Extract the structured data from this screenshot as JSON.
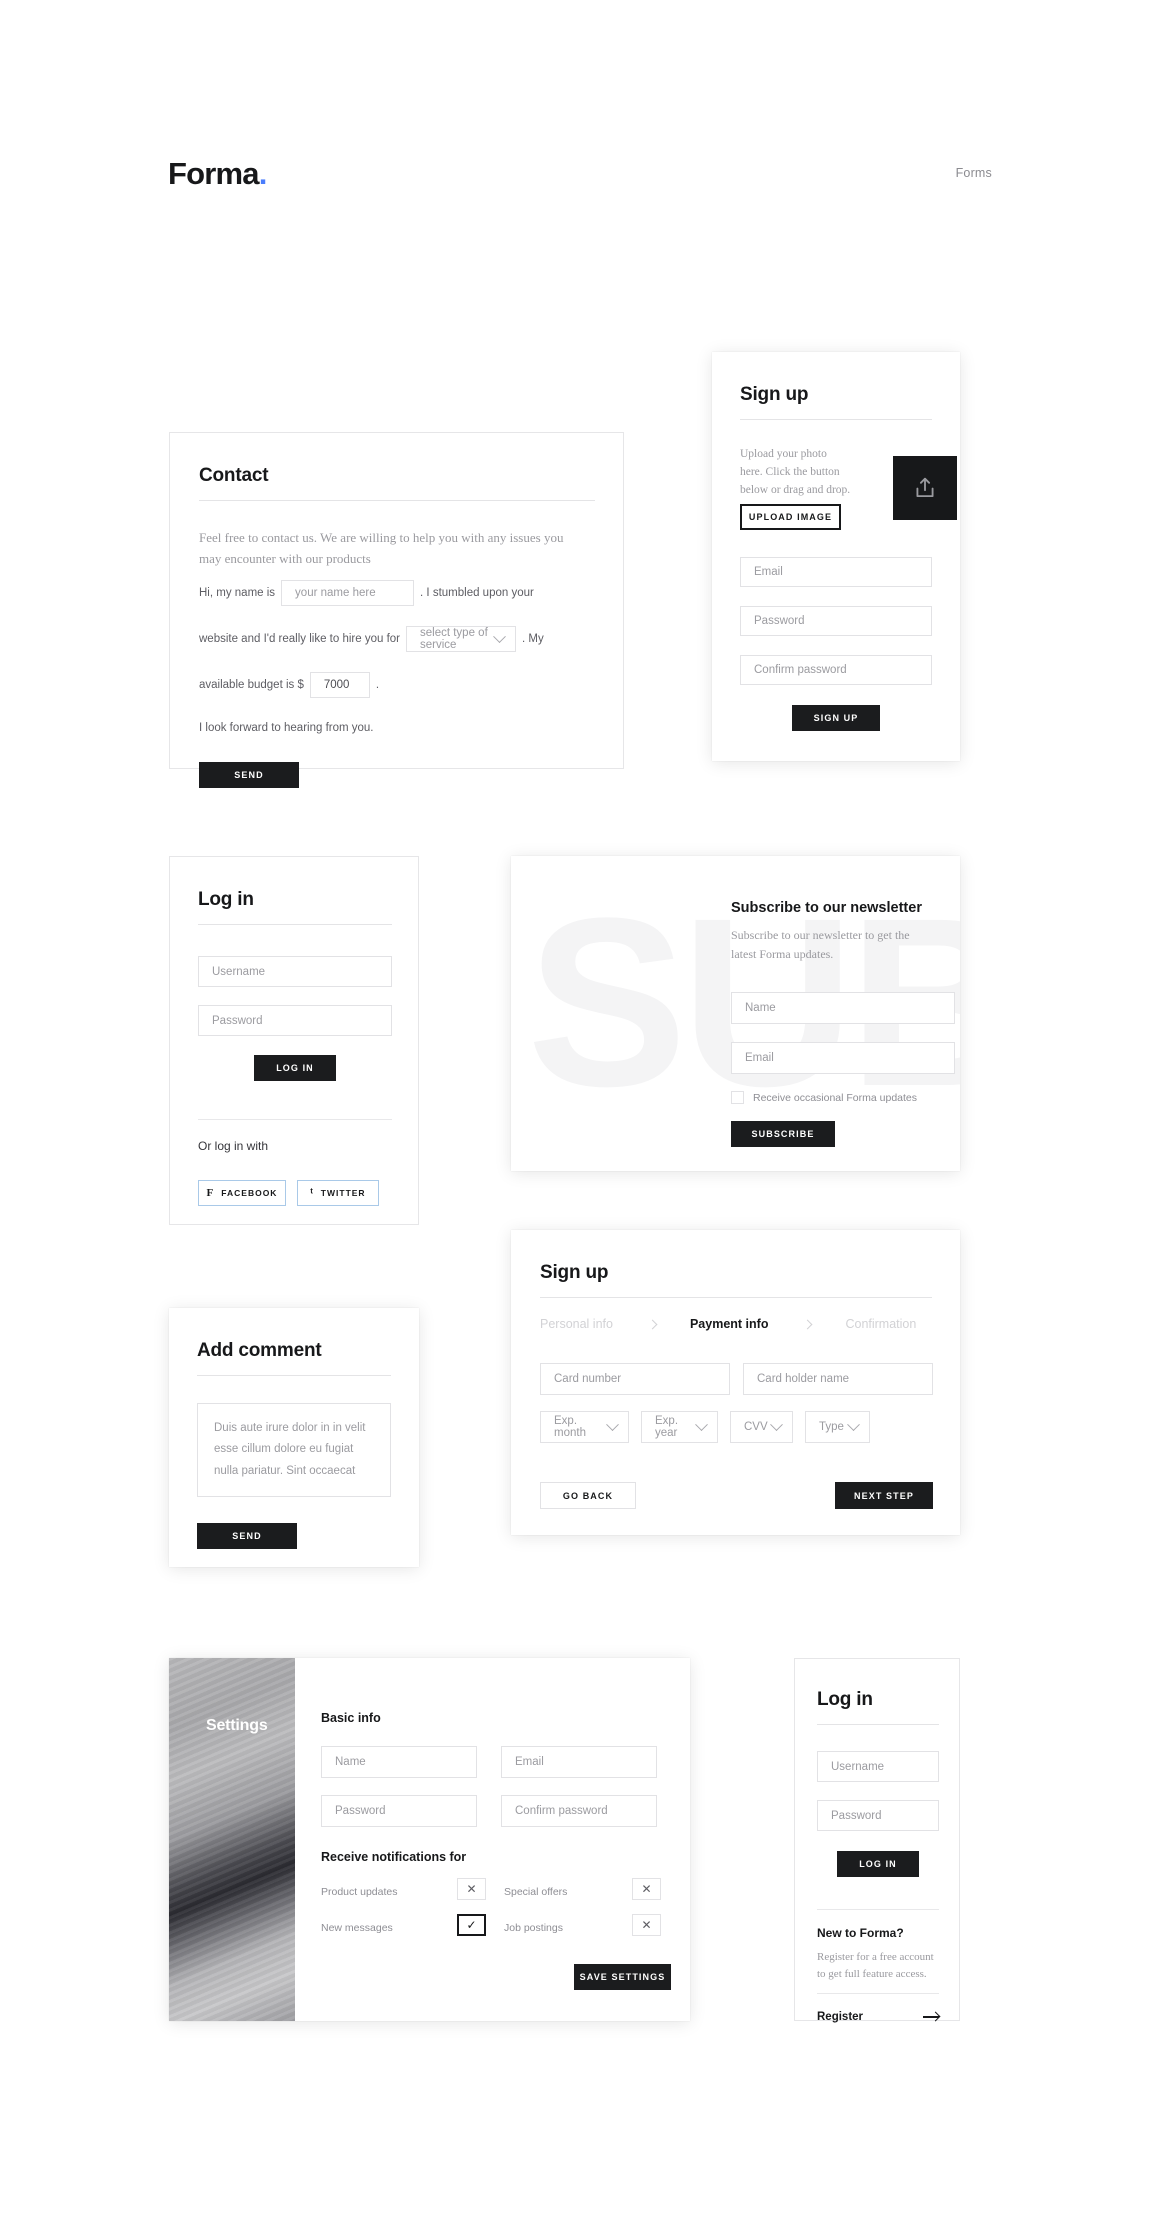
{
  "header": {
    "logo": "Forma",
    "logo_dot": ".",
    "nav_label": "Forms"
  },
  "contact": {
    "title": "Contact",
    "intro": "Feel free to contact us. We are willing to help you with any issues you may encounter with our products",
    "line1_prefix": "Hi, my name is",
    "name_placeholder": "your name here",
    "line1_suffix": ". I stumbled upon your",
    "line2_prefix": "website and I'd really like to hire you for",
    "service_value": "select type of service",
    "line2_suffix": ". My",
    "line3_prefix": "available budget is $",
    "budget_value": "7000",
    "line3_suffix": ".",
    "closing": "I look forward to hearing from you.",
    "send_label": "SEND"
  },
  "signup_photo": {
    "title": "Sign up",
    "upload_text": "Upload your photo here. Click the button below or drag and drop.",
    "upload_button": "UPLOAD IMAGE",
    "upload_icon": "upload-icon",
    "email_placeholder": "Email",
    "password_placeholder": "Password",
    "confirm_placeholder": "Confirm password",
    "submit_label": "SIGN UP"
  },
  "login_social": {
    "title": "Log in",
    "username_placeholder": "Username",
    "password_placeholder": "Password",
    "login_label": "LOG IN",
    "or_label": "Or log in with",
    "facebook_label": "FACEBOOK",
    "facebook_icon": "facebook-icon",
    "twitter_label": "TWITTER",
    "twitter_icon": "twitter-icon"
  },
  "newsletter": {
    "watermark": "SUB",
    "title": "Subscribe to our newsletter",
    "description": "Subscribe to our newsletter to get the latest Forma updates.",
    "name_placeholder": "Name",
    "email_placeholder": "Email",
    "checkbox_label": "Receive occasional Forma updates",
    "checkbox_checked": false,
    "submit_label": "SUBSCRIBE"
  },
  "comment": {
    "title": "Add comment",
    "textarea_value": "Duis aute irure dolor in in velit esse cillum dolore eu fugiat nulla pariatur. Sint occaecat",
    "send_label": "SEND"
  },
  "signup_payment": {
    "title": "Sign up",
    "steps": [
      {
        "label": "Personal info",
        "active": false
      },
      {
        "label": "Payment info",
        "active": true
      },
      {
        "label": "Confirmation",
        "active": false
      }
    ],
    "card_number_placeholder": "Card number",
    "card_holder_placeholder": "Card holder name",
    "exp_month": "Exp. month",
    "exp_year": "Exp. year",
    "cvv": "CVV",
    "type": "Type",
    "back_label": "GO BACK",
    "next_label": "NEXT STEP"
  },
  "settings": {
    "panel_label": "Settings",
    "basic_info_heading": "Basic info",
    "name_placeholder": "Name",
    "email_placeholder": "Email",
    "password_placeholder": "Password",
    "confirm_placeholder": "Confirm password",
    "notifications_heading": "Receive notifications for",
    "notifications": [
      {
        "label": "Product updates",
        "checked": false,
        "mark": "✕"
      },
      {
        "label": "Special offers",
        "checked": false,
        "mark": "✕"
      },
      {
        "label": "New messages",
        "checked": true,
        "mark": "✓"
      },
      {
        "label": "Job postings",
        "checked": false,
        "mark": "✕"
      }
    ],
    "save_label": "SAVE SETTINGS"
  },
  "login_register": {
    "title": "Log in",
    "username_placeholder": "Username",
    "password_placeholder": "Password",
    "login_label": "LOG IN",
    "new_heading": "New to Forma?",
    "new_text": "Register for a free account to get full feature access.",
    "register_label": "Register",
    "register_icon": "arrow-right-icon"
  },
  "colors": {
    "dark": "#1b1c1e",
    "accent_blue": "#4a7dfc",
    "social_border": "#a9c9e8",
    "muted_text": "#9b9ba0",
    "border": "#e2e2e5"
  }
}
